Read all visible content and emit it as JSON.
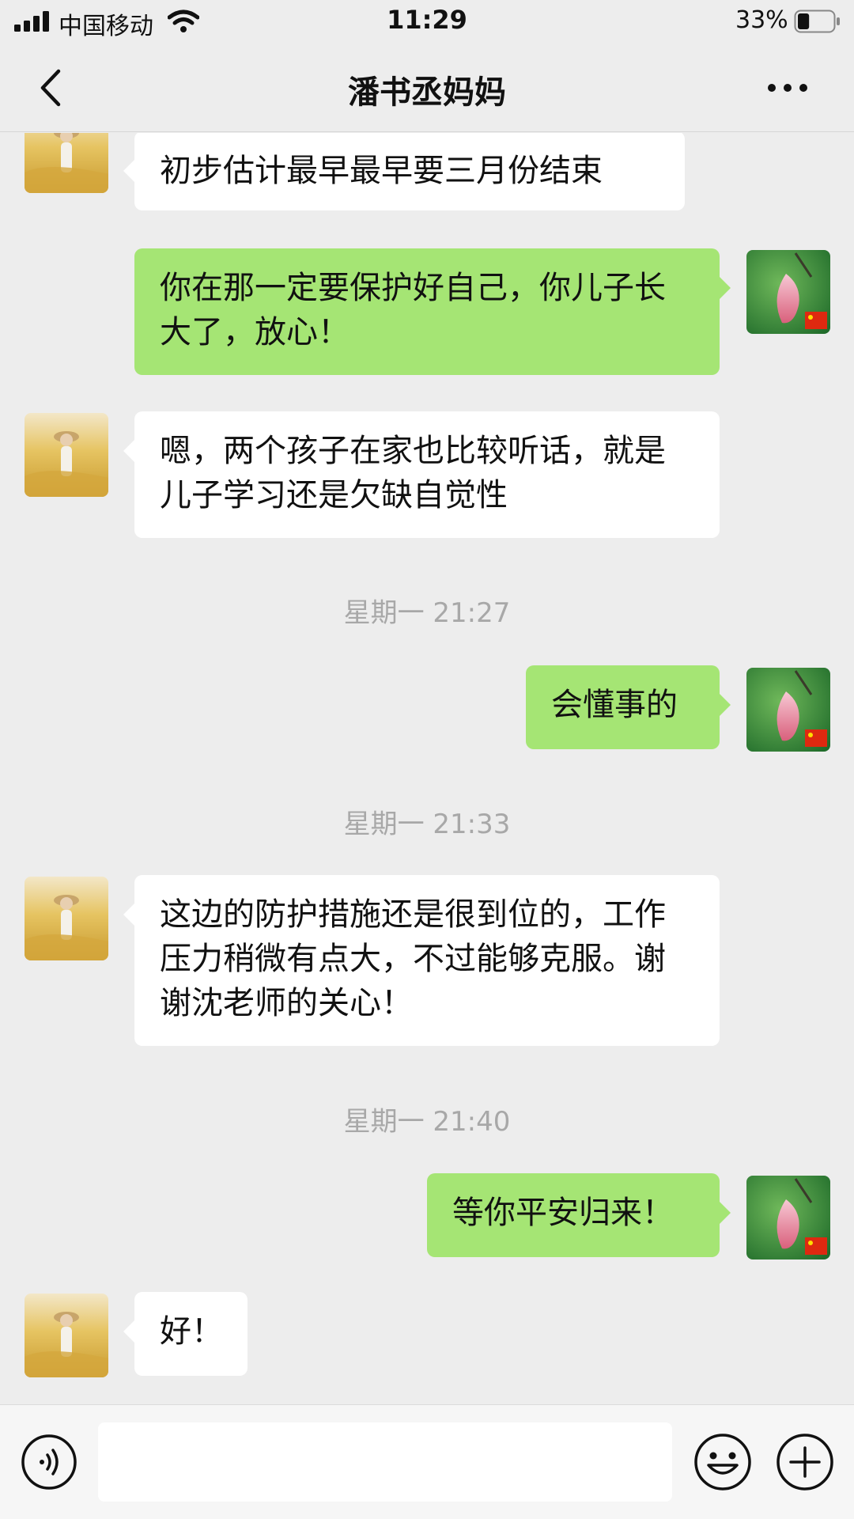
{
  "status_bar": {
    "carrier": "中国移动",
    "time": "11:29",
    "battery_percent": "33%",
    "battery_level": 0.33,
    "icons": [
      "signal-icon",
      "wifi-icon",
      "battery-icon"
    ]
  },
  "nav": {
    "title": "潘书丞妈妈",
    "icons": [
      "back-chevron-icon",
      "more-dots-icon"
    ]
  },
  "messages": [
    {
      "side": "in",
      "text": "初步估计最早最早要三月份结束"
    },
    {
      "side": "out",
      "text": "你在那一定要保护好自己，你儿子长大了，放心！"
    },
    {
      "side": "in",
      "text": "嗯，两个孩子在家也比较听话，就是儿子学习还是欠缺自觉性"
    },
    {
      "type": "time",
      "text": "星期一 21:27"
    },
    {
      "side": "out",
      "text": "会懂事的"
    },
    {
      "type": "time",
      "text": "星期一 21:33"
    },
    {
      "side": "in",
      "text": "这边的防护措施还是很到位的，工作压力稍微有点大，不过能够克服。谢谢沈老师的关心！"
    },
    {
      "type": "time",
      "text": "星期一 21:40"
    },
    {
      "side": "out",
      "text": "等你平安归来！"
    },
    {
      "side": "in",
      "text": "好！"
    }
  ],
  "input_bar": {
    "value": "",
    "icons": [
      "voice-icon",
      "emoji-icon",
      "plus-icon"
    ]
  },
  "colors": {
    "background": "#ededed",
    "outgoing_bubble": "#a5e574",
    "incoming_bubble": "#ffffff",
    "timestamp": "#a8a8a8"
  }
}
